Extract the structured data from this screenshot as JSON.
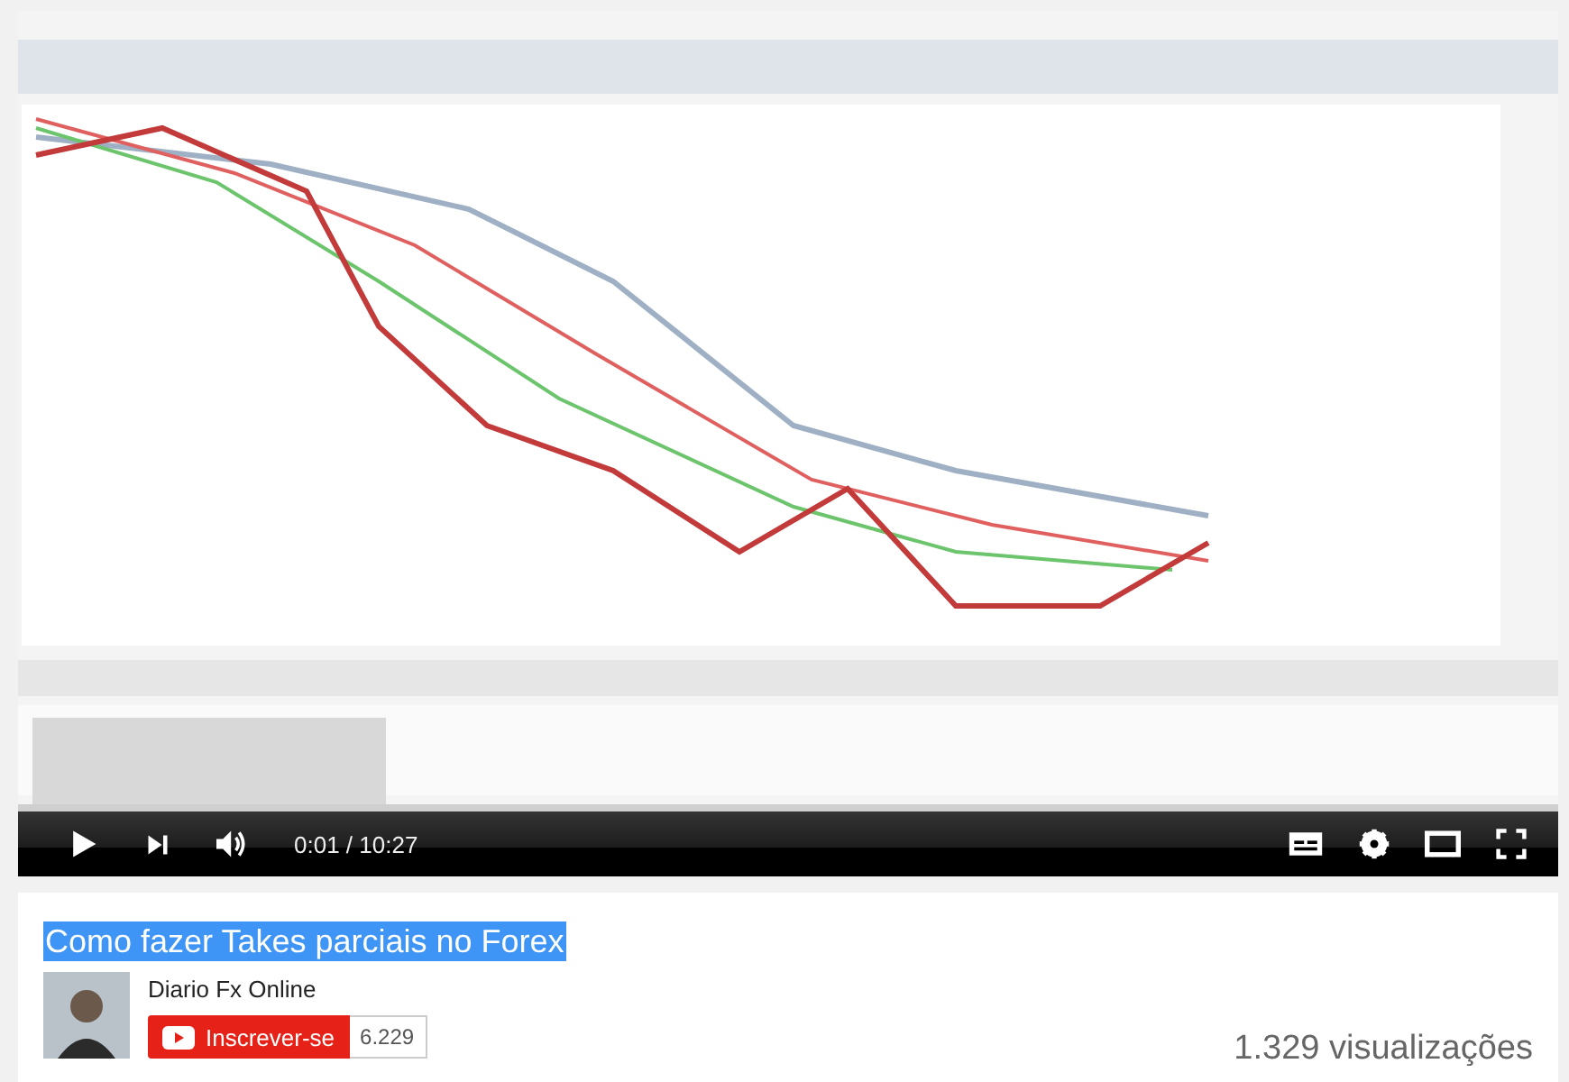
{
  "player": {
    "time": "0:01 / 10:27"
  },
  "video": {
    "title": "Como fazer Takes parciais no Forex",
    "title_selected": true
  },
  "channel": {
    "name": "Diario Fx Online",
    "subscribe_label": "Inscrever-se",
    "subscriber_count": "6.229"
  },
  "views": "1.329 visualizações"
}
